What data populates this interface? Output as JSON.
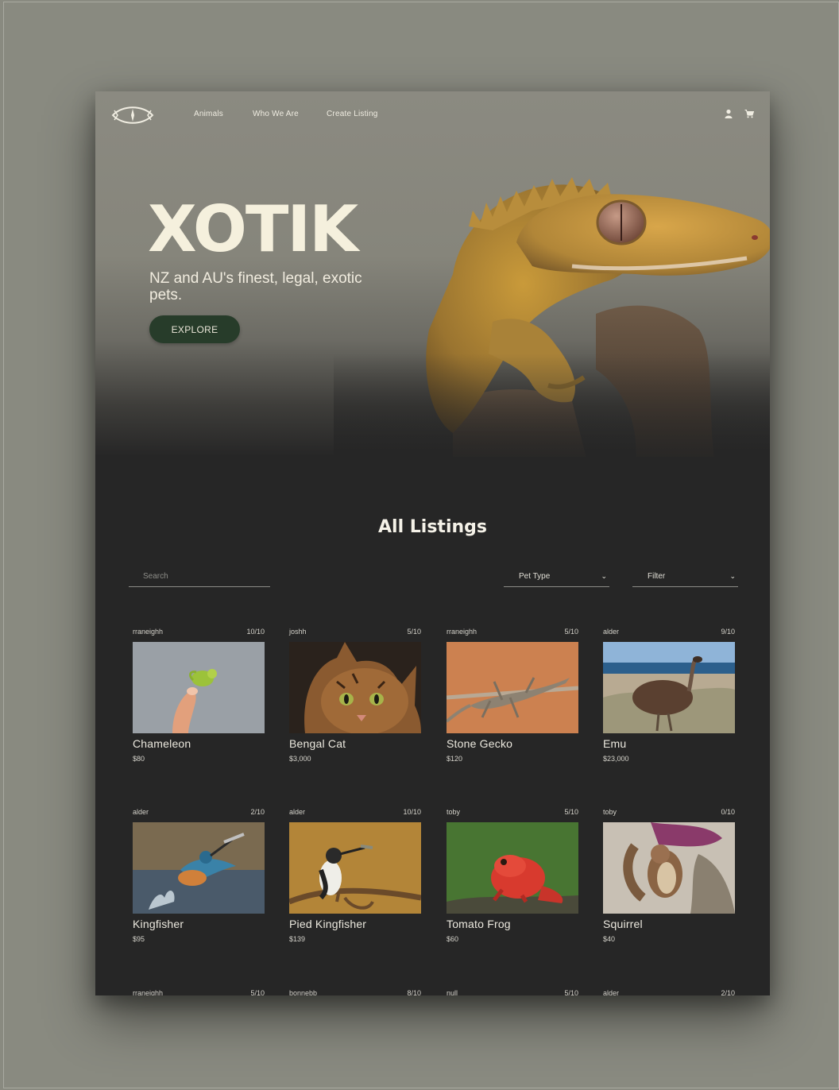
{
  "nav": {
    "links": [
      "Animals",
      "Who We Are",
      "Create Listing"
    ],
    "icons": [
      "user-icon",
      "cart-icon"
    ]
  },
  "hero": {
    "title": "XOTIK",
    "subtitle": "NZ and AU's finest, legal, exotic pets.",
    "cta_label": "EXPLORE"
  },
  "listings": {
    "title": "All Listings",
    "search_placeholder": "Search",
    "pet_type_label": "Pet Type",
    "filter_label": "Filter",
    "items": [
      {
        "user": "rraneighh",
        "rating": "10/10",
        "name": "Chameleon",
        "price": "$80"
      },
      {
        "user": "joshh",
        "rating": "5/10",
        "name": "Bengal Cat",
        "price": "$3,000"
      },
      {
        "user": "rraneighh",
        "rating": "5/10",
        "name": "Stone Gecko",
        "price": "$120"
      },
      {
        "user": "alder",
        "rating": "9/10",
        "name": "Emu",
        "price": "$23,000"
      },
      {
        "user": "alder",
        "rating": "2/10",
        "name": "Kingfisher",
        "price": "$95"
      },
      {
        "user": "alder",
        "rating": "10/10",
        "name": "Pied Kingfisher",
        "price": "$139"
      },
      {
        "user": "toby",
        "rating": "5/10",
        "name": "Tomato Frog",
        "price": "$60"
      },
      {
        "user": "toby",
        "rating": "0/10",
        "name": "Squirrel",
        "price": "$40"
      },
      {
        "user": "rraneighh",
        "rating": "5/10",
        "name": "",
        "price": ""
      },
      {
        "user": "bonnebb",
        "rating": "8/10",
        "name": "",
        "price": ""
      },
      {
        "user": "null",
        "rating": "5/10",
        "name": "",
        "price": ""
      },
      {
        "user": "alder",
        "rating": "2/10",
        "name": "",
        "price": ""
      }
    ]
  },
  "colors": {
    "backdrop": "#898a80",
    "page_bg": "#262626",
    "cta": "#273c2a",
    "hero_text": "#f5f0dd"
  }
}
